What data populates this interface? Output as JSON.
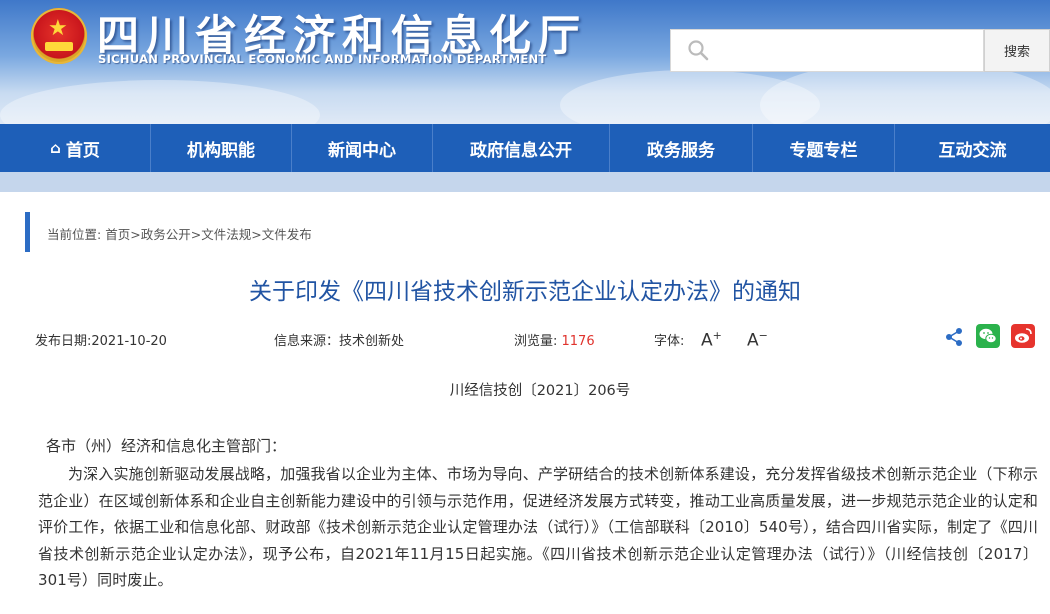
{
  "header": {
    "title": "四川省经济和信息化厅",
    "subtitle": "SICHUAN PROVINCIAL ECONOMIC AND INFORMATION DEPARTMENT",
    "search_placeholder": "",
    "search_button": "搜索",
    "icons": {
      "emblem": "national-emblem",
      "search": "search-icon"
    }
  },
  "nav": {
    "items": [
      {
        "label": "首页",
        "icon": "home-icon"
      },
      {
        "label": "机构职能"
      },
      {
        "label": "新闻中心"
      },
      {
        "label": "政府信息公开"
      },
      {
        "label": "政务服务"
      },
      {
        "label": "专题专栏"
      },
      {
        "label": "互动交流"
      }
    ]
  },
  "breadcrumb": {
    "prefix": "当前位置: ",
    "items": [
      "首页",
      "政务公开",
      "文件法规",
      "文件发布"
    ],
    "separator": ">"
  },
  "article": {
    "title": "关于印发《四川省技术创新示范企业认定办法》的通知",
    "publish_date_label": "发布日期:",
    "publish_date": "2021-10-20",
    "source_label": "信息来源：",
    "source": "技术创新处",
    "views_label": "浏览量: ",
    "views": "1176",
    "font_label": "字体:",
    "font_increase": "A",
    "font_decrease": "A",
    "doc_number": "川经信技创〔2021〕206号",
    "salutation": "各市（州）经济和信息化主管部门：",
    "body": "为深入实施创新驱动发展战略，加强我省以企业为主体、市场为导向、产学研结合的技术创新体系建设，充分发挥省级技术创新示范企业（下称示范企业）在区域创新体系和企业自主创新能力建设中的引领与示范作用，促进经济发展方式转变，推动工业高质量发展，进一步规范示范企业的认定和评价工作，依据工业和信息化部、财政部《技术创新示范企业认定管理办法（试行）》（工信部联科〔2010〕540号），结合四川省实际，制定了《四川省技术创新示范企业认定办法》，现予公布，自2021年11月15日起实施。《四川省技术创新示范企业认定管理办法（试行）》（川经信技创〔2017〕301号）同时废止。"
  },
  "share": {
    "icons": [
      "share-icon",
      "wechat-icon",
      "weibo-icon"
    ]
  },
  "colors": {
    "nav": "#1e5fb8",
    "title": "#2154a3",
    "accent": "#2c6cc4",
    "views": "#e0332d"
  }
}
